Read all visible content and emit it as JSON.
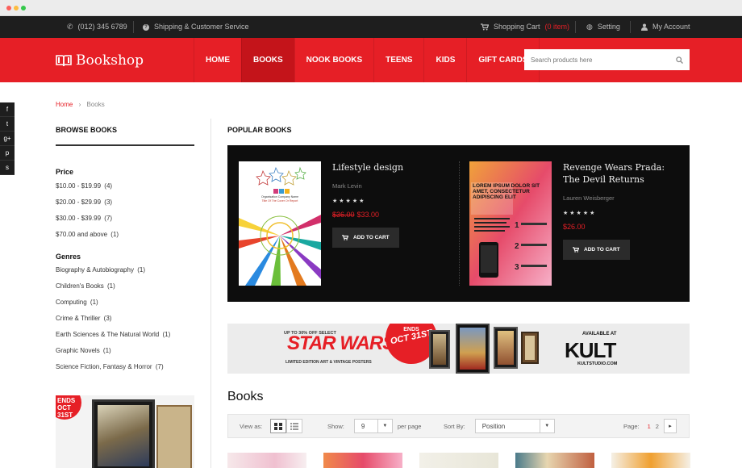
{
  "topbar": {
    "phone": "(012) 345 6789",
    "shipping": "Shipping & Customer Service",
    "cart_label": "Shopping Cart",
    "cart_count": "(0 item)",
    "setting": "Setting",
    "account": "My Account"
  },
  "header": {
    "logo": "Bookshop",
    "nav": [
      "HOME",
      "BOOKS",
      "NOOK BOOKS",
      "TEENS",
      "KIDS",
      "GIFT CARDS"
    ],
    "active_nav": "BOOKS",
    "search_placeholder": "Search products here"
  },
  "social": [
    "f",
    "t",
    "g+",
    "p",
    "s"
  ],
  "breadcrumb": {
    "home": "Home",
    "current": "Books"
  },
  "sidebar": {
    "title": "BROWSE BOOKS",
    "price_heading": "Price",
    "prices": [
      {
        "label": "$10.00 - $19.99",
        "count": "(4)"
      },
      {
        "label": "$20.00 - $29.99",
        "count": "(3)"
      },
      {
        "label": "$30.00 - $39.99",
        "count": "(7)"
      },
      {
        "label": "$70.00 and above",
        "count": "(1)"
      }
    ],
    "genres_heading": "Genres",
    "genres": [
      {
        "label": "Biography & Autobiography",
        "count": "(1)"
      },
      {
        "label": "Children's Books",
        "count": "(1)"
      },
      {
        "label": "Computing",
        "count": "(1)"
      },
      {
        "label": "Crime & Thriller",
        "count": "(3)"
      },
      {
        "label": "Earth Sciences & The Natural World",
        "count": "(1)"
      },
      {
        "label": "Graphic Novels",
        "count": "(1)"
      },
      {
        "label": "Science Fiction, Fantasy & Horror",
        "count": "(7)"
      }
    ],
    "banner_text": "ENDS OCT 31ST"
  },
  "popular": {
    "title": "POPULAR BOOKS",
    "items": [
      {
        "title": "Lifestyle design",
        "author": "Mark Levin",
        "old_price": "$36.00",
        "price": "$33.00",
        "button": "ADD TO CART",
        "cover_company": "Organisation Company Name",
        "cover_title": "Title Of The Cover Or Report"
      },
      {
        "title": "Revenge Wears Prada: The Devil Returns",
        "author": "Lauren Weisberger",
        "old_price": "",
        "price": "$26.00",
        "button": "ADD TO CART",
        "cover_text": "LOREM IPSUM DOLOR SIT AMET, CONSECTETUR ADIPISCING ELIT"
      }
    ],
    "stars": "★★★★★"
  },
  "promo": {
    "top": "UP TO 30% OFF SELECT",
    "headline": "STAR WARS",
    "sub": "LIMITED EDITION ART & VINTAGE POSTERS",
    "ends_1": "ENDS",
    "ends_2": "OCT 31ST",
    "available": "AVAILABLE AT",
    "brand": "KULT",
    "url": "KULTSTUDIO.COM"
  },
  "books": {
    "title": "Books",
    "view_as": "View as:",
    "show": "Show:",
    "show_value": "9",
    "per_page": "per page",
    "sort_by": "Sort By:",
    "sort_value": "Position",
    "page_label": "Page:",
    "pages": [
      "1",
      "2"
    ]
  },
  "colors": {
    "brand_red": "#e61f26",
    "dark": "#1e1e1e"
  }
}
